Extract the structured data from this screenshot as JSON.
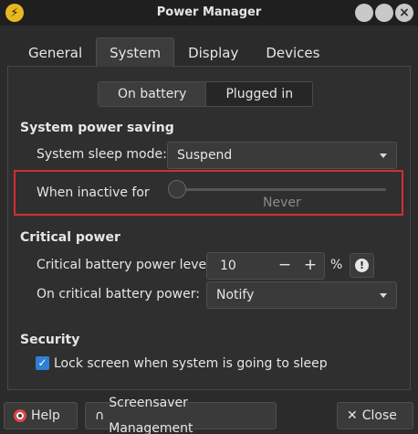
{
  "window": {
    "title": "Power Manager",
    "icon": "lightning-icon"
  },
  "tabs": [
    {
      "label": "General",
      "active": false
    },
    {
      "label": "System",
      "active": true
    },
    {
      "label": "Display",
      "active": false
    },
    {
      "label": "Devices",
      "active": false
    }
  ],
  "power_source": {
    "on_battery": "On battery",
    "plugged_in": "Plugged in",
    "selected": "On battery"
  },
  "system_power_saving": {
    "heading": "System power saving",
    "sleep_mode_label": "System sleep mode:",
    "sleep_mode_value": "Suspend",
    "inactive_label": "When inactive for",
    "inactive_value": "Never",
    "inactive_level": 0
  },
  "critical_power": {
    "heading": "Critical power",
    "level_label": "Critical battery power level:",
    "level_value": "10",
    "minus": "−",
    "plus": "+",
    "unit": "%",
    "action_label": "On critical battery power:",
    "action_value": "Notify"
  },
  "security": {
    "heading": "Security",
    "lock_screen_label": "Lock screen when system is going to sleep",
    "lock_screen_checked": true
  },
  "buttons": {
    "help": "Help",
    "screensaver": "Screensaver Management",
    "close": "Close"
  },
  "colors": {
    "highlight": "#d42d35",
    "checkbox": "#2f7fd6",
    "app_icon": "#e8b820"
  }
}
